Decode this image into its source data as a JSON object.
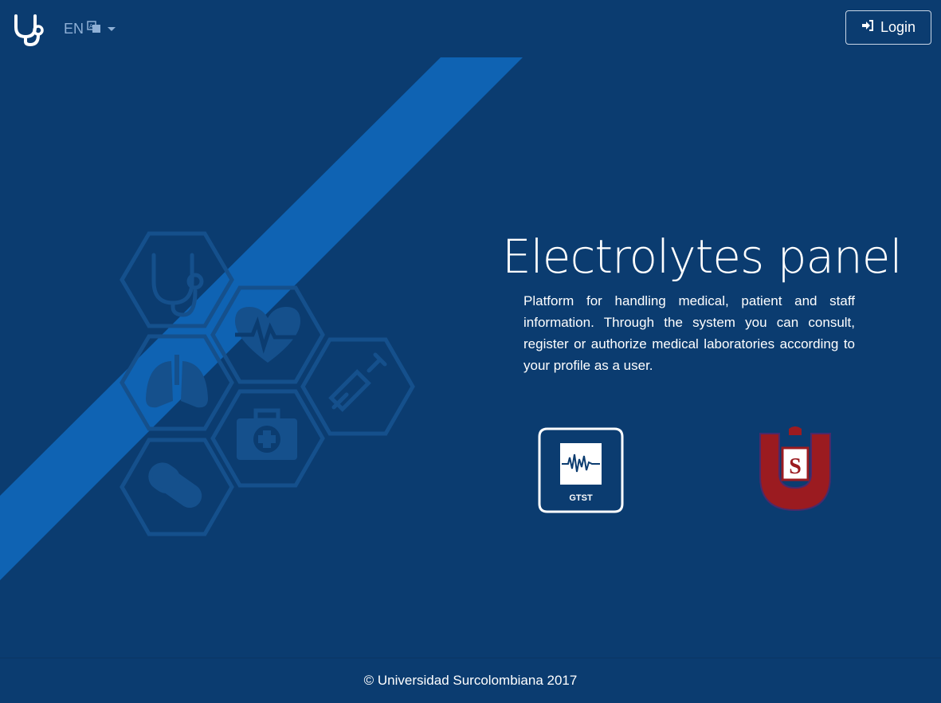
{
  "navbar": {
    "brand_icon": "stethoscope-icon",
    "language": {
      "code": "EN",
      "icon": "translate-icon"
    },
    "login": {
      "label": "Login",
      "icon": "sign-in-icon"
    }
  },
  "hero": {
    "title": "Electrolytes panel",
    "description": "Platform for handling medical, patient and staff information. Through the system you can consult, register or authorize medical laboratories according to your profile as a user.",
    "icons": [
      "stethoscope-icon",
      "heartbeat-icon",
      "lungs-icon",
      "syringe-icon",
      "first-aid-kit-icon",
      "pill-icon"
    ]
  },
  "logos": {
    "gtst": {
      "label": "GTST"
    },
    "university": {
      "name": "Universidad Surcolombiana",
      "letter": "S"
    }
  },
  "footer": {
    "text": "© Universidad Surcolombiana 2017"
  },
  "colors": {
    "background": "#0b3c70",
    "stripe": "#0f63b3",
    "hex_outline": "#15508c",
    "university_red": "#9b1b20"
  }
}
